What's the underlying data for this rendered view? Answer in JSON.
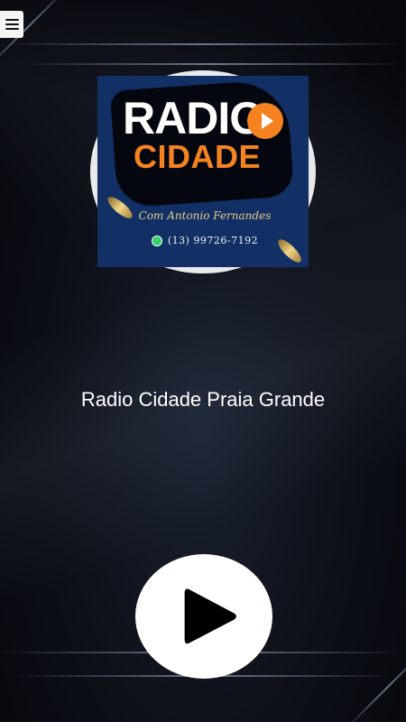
{
  "header": {
    "menu_icon": "hamburger-menu-icon"
  },
  "logo": {
    "word_top": "RADIO",
    "word_bottom": "CIDADE",
    "host": "Com Antonio Fernandes",
    "phone": "(13) 99726-7192",
    "phone_icon": "whatsapp-icon",
    "colors": {
      "brand_orange": "#f58220",
      "brand_blue": "#123066"
    }
  },
  "station": {
    "title": "Radio Cidade Praia Grande"
  },
  "player": {
    "play_icon": "play-icon",
    "button_color": "#ffffff"
  }
}
